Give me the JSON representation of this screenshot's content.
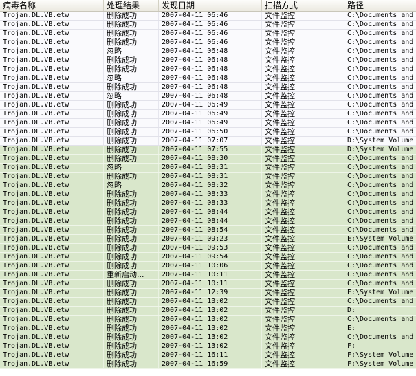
{
  "colors": {
    "header_bg_top": "#fdfdfb",
    "header_bg_bottom": "#ebe9e0",
    "row_bg": "#fafafd",
    "highlight_row_bg": "#d9e7cb",
    "text": "#000000"
  },
  "columns": [
    {
      "label": "病毒名称"
    },
    {
      "label": "处理结果"
    },
    {
      "label": "发现日期"
    },
    {
      "label": "扫描方式"
    },
    {
      "label": "路径"
    }
  ],
  "rows": [
    {
      "name": "Trojan.DL.VB.etw",
      "result": "删除成功",
      "date": "2007-04-11 06:46",
      "method": "文件监控",
      "path": "C:\\Documents and",
      "highlighted": false
    },
    {
      "name": "Trojan.DL.VB.etw",
      "result": "删除成功",
      "date": "2007-04-11 06:46",
      "method": "文件监控",
      "path": "C:\\Documents and",
      "highlighted": false
    },
    {
      "name": "Trojan.DL.VB.etw",
      "result": "删除成功",
      "date": "2007-04-11 06:46",
      "method": "文件监控",
      "path": "C:\\Documents and",
      "highlighted": false
    },
    {
      "name": "Trojan.DL.VB.etw",
      "result": "删除成功",
      "date": "2007-04-11 06:46",
      "method": "文件监控",
      "path": "C:\\Documents and",
      "highlighted": false
    },
    {
      "name": "Trojan.DL.VB.etw",
      "result": "忽略",
      "date": "2007-04-11 06:48",
      "method": "文件监控",
      "path": "C:\\Documents and",
      "highlighted": false
    },
    {
      "name": "Trojan.DL.VB.etw",
      "result": "删除成功",
      "date": "2007-04-11 06:48",
      "method": "文件监控",
      "path": "C:\\Documents and",
      "highlighted": false
    },
    {
      "name": "Trojan.DL.VB.etw",
      "result": "删除成功",
      "date": "2007-04-11 06:48",
      "method": "文件监控",
      "path": "C:\\Documents and",
      "highlighted": false
    },
    {
      "name": "Trojan.DL.VB.etw",
      "result": "忽略",
      "date": "2007-04-11 06:48",
      "method": "文件监控",
      "path": "C:\\Documents and",
      "highlighted": false
    },
    {
      "name": "Trojan.DL.VB.etw",
      "result": "删除成功",
      "date": "2007-04-11 06:48",
      "method": "文件监控",
      "path": "C:\\Documents and",
      "highlighted": false
    },
    {
      "name": "Trojan.DL.VB.etw",
      "result": "忽略",
      "date": "2007-04-11 06:48",
      "method": "文件监控",
      "path": "C:\\Documents and",
      "highlighted": false
    },
    {
      "name": "Trojan.DL.VB.etw",
      "result": "删除成功",
      "date": "2007-04-11 06:49",
      "method": "文件监控",
      "path": "C:\\Documents and",
      "highlighted": false
    },
    {
      "name": "Trojan.DL.VB.etw",
      "result": "删除成功",
      "date": "2007-04-11 06:49",
      "method": "文件监控",
      "path": "C:\\Documents and",
      "highlighted": false
    },
    {
      "name": "Trojan.DL.VB.etw",
      "result": "删除成功",
      "date": "2007-04-11 06:49",
      "method": "文件监控",
      "path": "C:\\Documents and",
      "highlighted": false
    },
    {
      "name": "Trojan.DL.VB.etw",
      "result": "删除成功",
      "date": "2007-04-11 06:50",
      "method": "文件监控",
      "path": "C:\\Documents and",
      "highlighted": false
    },
    {
      "name": "Trojan.DL.VB.etw",
      "result": "删除成功",
      "date": "2007-04-11 07:07",
      "method": "文件监控",
      "path": "D:\\System Volume",
      "highlighted": false
    },
    {
      "name": "Trojan.DL.VB.etw",
      "result": "删除成功",
      "date": "2007-04-11 07:55",
      "method": "文件监控",
      "path": "D:\\System Volume",
      "highlighted": true
    },
    {
      "name": "Trojan.DL.VB.etw",
      "result": "删除成功",
      "date": "2007-04-11 08:30",
      "method": "文件监控",
      "path": "C:\\Documents and",
      "highlighted": true
    },
    {
      "name": "Trojan.DL.VB.etw",
      "result": "忽略",
      "date": "2007-04-11 08:31",
      "method": "文件监控",
      "path": "C:\\Documents and",
      "highlighted": true
    },
    {
      "name": "Trojan.DL.VB.etw",
      "result": "删除成功",
      "date": "2007-04-11 08:31",
      "method": "文件监控",
      "path": "C:\\Documents and",
      "highlighted": true
    },
    {
      "name": "Trojan.DL.VB.etw",
      "result": "忽略",
      "date": "2007-04-11 08:32",
      "method": "文件监控",
      "path": "C:\\Documents and",
      "highlighted": true
    },
    {
      "name": "Trojan.DL.VB.etw",
      "result": "删除成功",
      "date": "2007-04-11 08:33",
      "method": "文件监控",
      "path": "C:\\Documents and",
      "highlighted": true
    },
    {
      "name": "Trojan.DL.VB.etw",
      "result": "删除成功",
      "date": "2007-04-11 08:33",
      "method": "文件监控",
      "path": "C:\\Documents and",
      "highlighted": true
    },
    {
      "name": "Trojan.DL.VB.etw",
      "result": "删除成功",
      "date": "2007-04-11 08:44",
      "method": "文件监控",
      "path": "C:\\Documents and",
      "highlighted": true
    },
    {
      "name": "Trojan.DL.VB.etw",
      "result": "删除成功",
      "date": "2007-04-11 08:44",
      "method": "文件监控",
      "path": "C:\\Documents and",
      "highlighted": true
    },
    {
      "name": "Trojan.DL.VB.etw",
      "result": "删除成功",
      "date": "2007-04-11 08:54",
      "method": "文件监控",
      "path": "C:\\Documents and",
      "highlighted": true
    },
    {
      "name": "Trojan.DL.VB.etw",
      "result": "删除成功",
      "date": "2007-04-11 09:23",
      "method": "文件监控",
      "path": "E:\\System Volume",
      "highlighted": true
    },
    {
      "name": "Trojan.DL.VB.etw",
      "result": "删除成功",
      "date": "2007-04-11 09:53",
      "method": "文件监控",
      "path": "C:\\Documents and",
      "highlighted": true
    },
    {
      "name": "Trojan.DL.VB.etw",
      "result": "删除成功",
      "date": "2007-04-11 09:54",
      "method": "文件监控",
      "path": "C:\\Documents and",
      "highlighted": true
    },
    {
      "name": "Trojan.DL.VB.etw",
      "result": "删除成功",
      "date": "2007-04-11 10:06",
      "method": "文件监控",
      "path": "C:\\Documents and",
      "highlighted": true
    },
    {
      "name": "Trojan.DL.VB.etw",
      "result": "重新启动...",
      "date": "2007-04-11 10:11",
      "method": "文件监控",
      "path": "C:\\Documents and",
      "highlighted": true
    },
    {
      "name": "Trojan.DL.VB.etw",
      "result": "删除成功",
      "date": "2007-04-11 10:11",
      "method": "文件监控",
      "path": "C:\\Documents and",
      "highlighted": true
    },
    {
      "name": "Trojan.DL.VB.etw",
      "result": "删除成功",
      "date": "2007-04-11 12:39",
      "method": "文件监控",
      "path": "E:\\System Volume",
      "highlighted": true
    },
    {
      "name": "Trojan.DL.VB.etw",
      "result": "删除成功",
      "date": "2007-04-11 13:02",
      "method": "文件监控",
      "path": "C:\\Documents and",
      "highlighted": true
    },
    {
      "name": "Trojan.DL.VB.etw",
      "result": "删除成功",
      "date": "2007-04-11 13:02",
      "method": "文件监控",
      "path": "D:",
      "highlighted": true
    },
    {
      "name": "Trojan.DL.VB.etw",
      "result": "删除成功",
      "date": "2007-04-11 13:02",
      "method": "文件监控",
      "path": "C:\\Documents and",
      "highlighted": true
    },
    {
      "name": "Trojan.DL.VB.etw",
      "result": "删除成功",
      "date": "2007-04-11 13:02",
      "method": "文件监控",
      "path": "E:",
      "highlighted": true
    },
    {
      "name": "Trojan.DL.VB.etw",
      "result": "删除成功",
      "date": "2007-04-11 13:02",
      "method": "文件监控",
      "path": "C:\\Documents and",
      "highlighted": true
    },
    {
      "name": "Trojan.DL.VB.etw",
      "result": "删除成功",
      "date": "2007-04-11 13:02",
      "method": "文件监控",
      "path": "F:",
      "highlighted": true
    },
    {
      "name": "Trojan.DL.VB.etw",
      "result": "删除成功",
      "date": "2007-04-11 16:11",
      "method": "文件监控",
      "path": "F:\\System Volume",
      "highlighted": true
    },
    {
      "name": "Trojan.DL.VB.etw",
      "result": "删除成功",
      "date": "2007-04-11 16:59",
      "method": "文件监控",
      "path": "F:\\System Volume",
      "highlighted": true
    }
  ]
}
